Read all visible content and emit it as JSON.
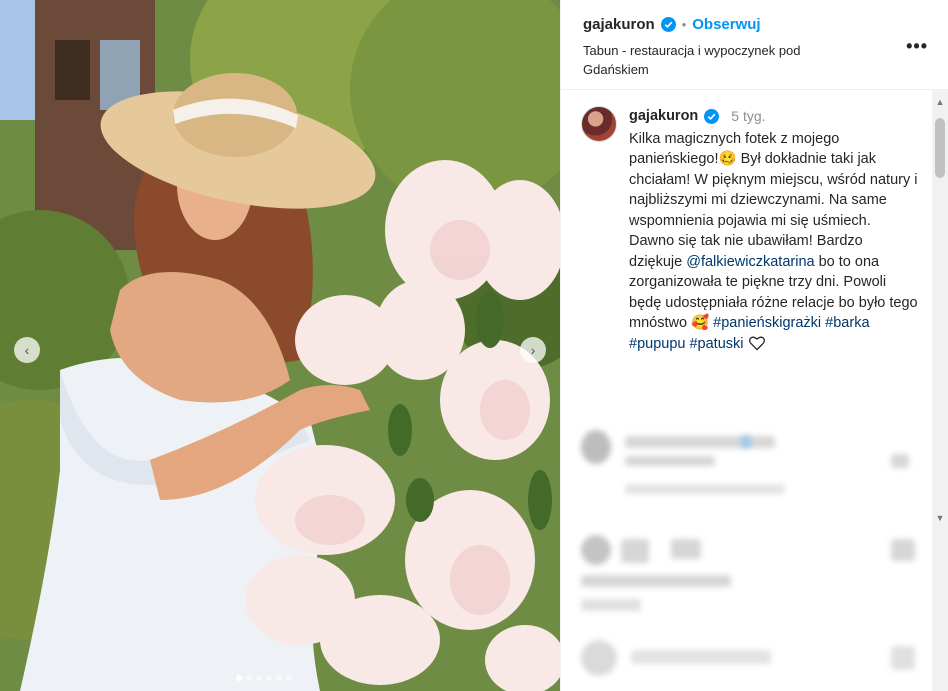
{
  "post": {
    "username": "gajakuron",
    "separator": "•",
    "follow_label": "Obserwuj",
    "location": "Tabun - restauracja i wypoczynek pod Gdańskiem",
    "more_label": "•••"
  },
  "caption": {
    "username": "gajakuron",
    "time": "5 tyg.",
    "text_1": "Kilka magicznych fotek z mojego panieńskiego!🥴 Był dokładnie taki jak chciałam! W pięknym miejscu, wśród natury i najbliższymi mi dziewczynami. Na same wspomnienia pojawia mi się uśmiech. Dawno się tak nie ubawiłam! Bardzo dziękuje ",
    "mention": "@falkiewiczkatarina",
    "text_2": " bo to ona zorganizowała te piękne trzy dni. Powoli będę udostępniała różne relacje bo było tego mnóstwo 🥰",
    "tags": "#panieńskigrażki #barka #pupupu #patuski"
  },
  "carousel": {
    "prev_icon": "‹",
    "next_icon": "›",
    "slide_count": 6,
    "active_slide": 1
  },
  "scrollbar": {
    "up_icon": "▲",
    "down_icon": "▼"
  },
  "colors": {
    "accent": "#0095f6",
    "verified": "#0095f6",
    "link": "#00376b"
  }
}
